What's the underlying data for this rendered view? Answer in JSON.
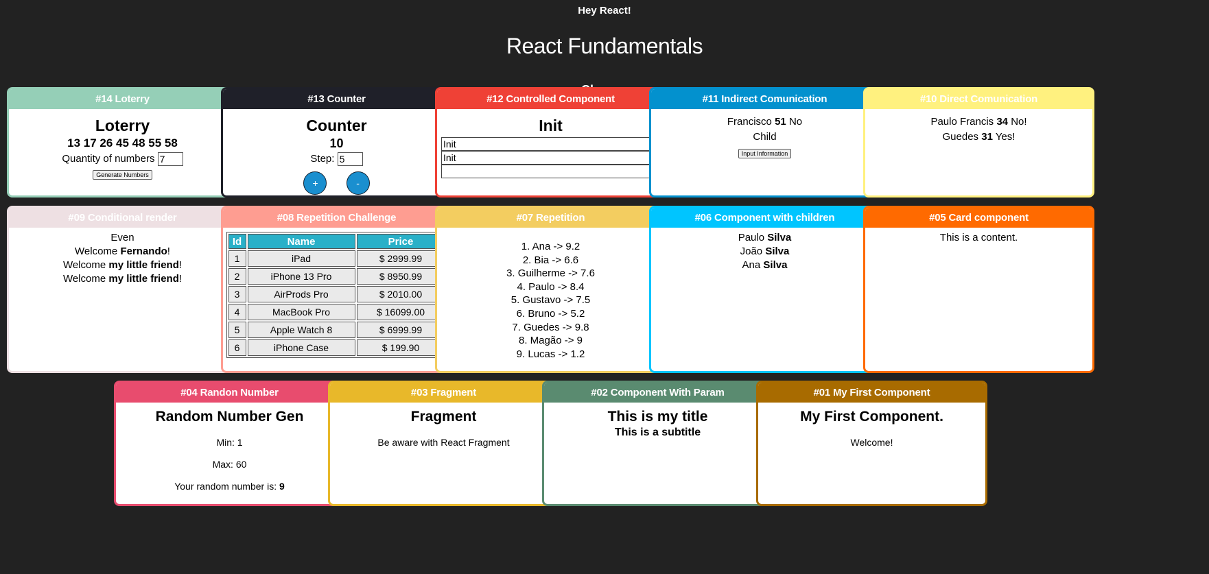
{
  "header": {
    "top_title": "Hey React!",
    "main_title": "React Fundamentals",
    "section_title": "Classes"
  },
  "colors": {
    "c14": "#95cfb7",
    "c13": "#1f2029",
    "c12": "#ef4136",
    "c11": "#0391ce",
    "c10": "#fff17f",
    "c09": "#eee0e3",
    "c08": "#fe9d91",
    "c07": "#f3cd60",
    "c06": "#00c5ff",
    "c05": "#ff6a00",
    "c04": "#e84c6e",
    "c03": "#e8b82a",
    "c02": "#5a8b70",
    "c01": "#a86b00"
  },
  "cards": {
    "c14": {
      "header": "#14 Loterry",
      "title": "Loterry",
      "numbers": "13 17 26 45 48 55 58",
      "qty_label": "Quantity of numbers",
      "qty_value": "7",
      "button": "Generate Numbers"
    },
    "c13": {
      "header": "#13 Counter",
      "title": "Counter",
      "value": "10",
      "step_label": "Step:",
      "step_value": "5",
      "plus": "+",
      "minus": "-"
    },
    "c12": {
      "header": "#12 Controlled Component",
      "title": "Init",
      "input1": "Init",
      "input2": "Init",
      "input3": ""
    },
    "c11": {
      "header": "#11 Indirect Comunication",
      "name": "Francisco",
      "age": "51",
      "answer": "No",
      "child": "Child",
      "button": "Input Information"
    },
    "c10": {
      "header": "#10 Direct Comunication",
      "rows": [
        {
          "name": "Paulo Francis",
          "age": "34",
          "answer": "No!"
        },
        {
          "name": "Guedes",
          "age": "31",
          "answer": "Yes!"
        }
      ]
    },
    "c09": {
      "header": "#09 Conditional render",
      "even": "Even",
      "welcome": "Welcome",
      "name1": "Fernando",
      "name2": "my little friend",
      "bang": "!"
    },
    "c08": {
      "header": "#08 Repetition Challenge",
      "columns": [
        "Id",
        "Name",
        "Price"
      ],
      "rows": [
        [
          "1",
          "iPad",
          "$ 2999.99"
        ],
        [
          "2",
          "iPhone 13 Pro",
          "$ 8950.99"
        ],
        [
          "3",
          "AirProds Pro",
          "$ 2010.00"
        ],
        [
          "4",
          "MacBook Pro",
          "$ 16099.00"
        ],
        [
          "5",
          "Apple Watch 8",
          "$ 6999.99"
        ],
        [
          "6",
          "iPhone Case",
          "$ 199.90"
        ]
      ]
    },
    "c07": {
      "header": "#07 Repetition",
      "items": [
        "1. Ana -> 9.2",
        "2. Bia -> 6.6",
        "3. Guilherme -> 7.6",
        "4. Paulo -> 8.4",
        "5. Gustavo -> 7.5",
        "6. Bruno -> 5.2",
        "7. Guedes -> 9.8",
        "8. Magão -> 9",
        "9. Lucas -> 1.2"
      ]
    },
    "c06": {
      "header": "#06 Component with children",
      "people": [
        {
          "first": "Paulo",
          "last": "Silva"
        },
        {
          "first": "João",
          "last": "Silva"
        },
        {
          "first": "Ana",
          "last": "Silva"
        }
      ]
    },
    "c05": {
      "header": "#05 Card component",
      "content": "This is a content."
    },
    "c04": {
      "header": "#04 Randon Number",
      "title": "Random Number Gen",
      "min": "Min: 1",
      "max": "Max: 60",
      "result_label": "Your random number is:",
      "result": "9"
    },
    "c03": {
      "header": "#03 Fragment",
      "title": "Fragment",
      "text": "Be aware with React Fragment"
    },
    "c02": {
      "header": "#02 Component With Param",
      "title": "This is my title",
      "subtitle": "This is a subtitle"
    },
    "c01": {
      "header": "#01 My First Component",
      "title": "My First Component.",
      "text": "Welcome!"
    }
  }
}
